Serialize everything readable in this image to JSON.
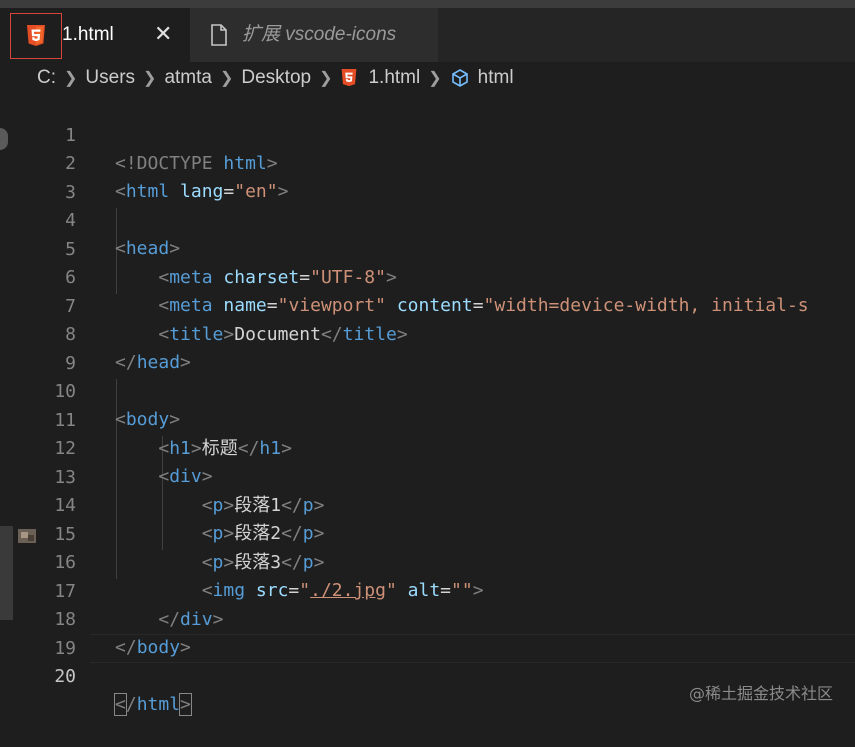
{
  "tabs": [
    {
      "label": "1.html",
      "close": "✕",
      "icon": "html5-icon"
    },
    {
      "label": "扩展 vscode-icons",
      "icon": "file-icon"
    }
  ],
  "breadcrumb": [
    "C:",
    "Users",
    "atmta",
    "Desktop",
    "1.html",
    "html"
  ],
  "editor": {
    "current_line": 20,
    "lines": [
      {
        "n": "1"
      },
      {
        "n": "2"
      },
      {
        "n": "3"
      },
      {
        "n": "4"
      },
      {
        "n": "5"
      },
      {
        "n": "6"
      },
      {
        "n": "7"
      },
      {
        "n": "8"
      },
      {
        "n": "9"
      },
      {
        "n": "10"
      },
      {
        "n": "11"
      },
      {
        "n": "12"
      },
      {
        "n": "13"
      },
      {
        "n": "14"
      },
      {
        "n": "15"
      },
      {
        "n": "16"
      },
      {
        "n": "17"
      },
      {
        "n": "18"
      },
      {
        "n": "19"
      },
      {
        "n": "20"
      }
    ],
    "tokens": {
      "doctype": "<!DOCTYPE",
      "html": "html",
      "lang": "lang",
      "en": "\"en\"",
      "head": "head",
      "meta": "meta",
      "charset": "charset",
      "utf8": "\"UTF-8\"",
      "name": "name",
      "viewport": "\"viewport\"",
      "content": "content",
      "content_val": "\"width=device-width, initial-s",
      "title": "title",
      "document": "Document",
      "body": "body",
      "h1": "h1",
      "h1_text": "标题",
      "div": "div",
      "p": "p",
      "p1": "段落1",
      "p2": "段落2",
      "p3": "段落3",
      "img": "img",
      "src": "src",
      "src_val": "./2.jpg",
      "alt": "alt",
      "alt_val": "\"\""
    }
  },
  "watermark": "@稀土掘金技术社区",
  "colors": {
    "tag": "#569cd6",
    "attr": "#9cdcfe",
    "string": "#ce9178",
    "text": "#d4d4d4",
    "bracket": "#808080"
  }
}
